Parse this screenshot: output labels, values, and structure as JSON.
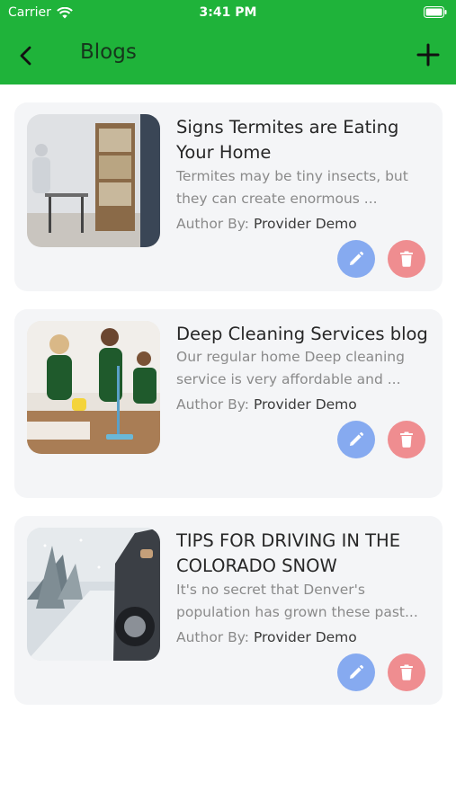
{
  "status_bar": {
    "carrier": "Carrier",
    "time": "3:41 PM"
  },
  "header": {
    "title": "Blogs"
  },
  "blogs": [
    {
      "title": "Signs Termites are Eating Your Home",
      "excerpt": "Termites may be tiny insects, but they can create enormous ...",
      "author_label": "Author By:",
      "author_name": "Provider Demo"
    },
    {
      "title": "Deep Cleaning Services blog",
      "excerpt": "Our regular home Deep cleaning service is very affordable and ...",
      "author_label": "Author By:",
      "author_name": "Provider Demo"
    },
    {
      "title": "TIPS FOR DRIVING IN THE COLORADO SNOW",
      "excerpt": "It's no secret that Denver's population has grown these past...",
      "author_label": "Author By:",
      "author_name": "Provider Demo"
    }
  ],
  "colors": {
    "brand_green": "#1fb33a",
    "edit_blue": "#86aaf0",
    "delete_red": "#ef8d90",
    "card_bg": "#f4f5f7"
  },
  "icons": {
    "back": "chevron-left-icon",
    "add": "plus-icon",
    "edit": "pencil-icon",
    "delete": "trash-icon",
    "wifi": "wifi-icon",
    "battery": "battery-icon"
  }
}
